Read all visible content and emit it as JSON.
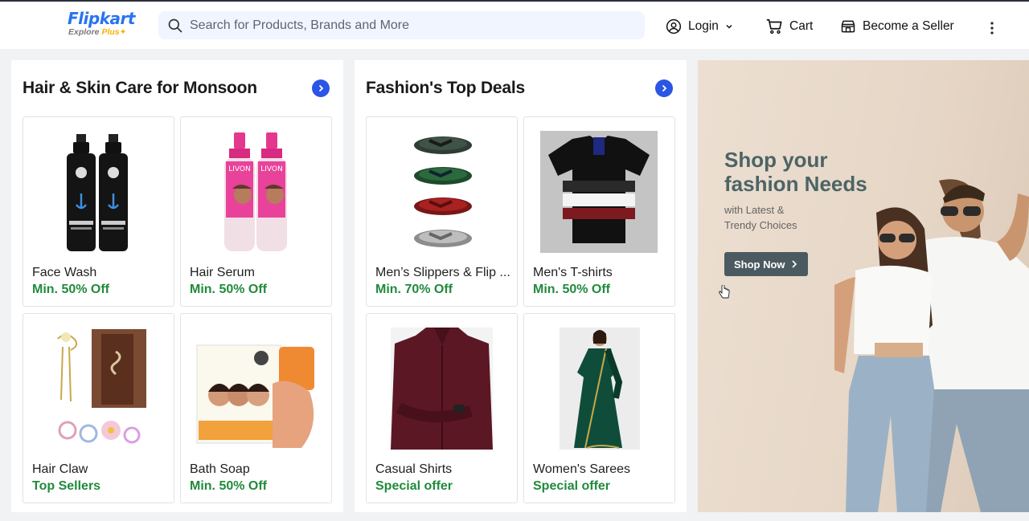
{
  "header": {
    "logo_main": "Flipkart",
    "logo_sub": "Explore",
    "logo_plus": "Plus",
    "search_placeholder": "Search for Products, Brands and More",
    "login_label": "Login",
    "cart_label": "Cart",
    "seller_label": "Become a Seller"
  },
  "sections": [
    {
      "title": "Hair & Skin Care for Monsoon",
      "items": [
        {
          "name": "Face Wash",
          "offer": "Min. 50% Off"
        },
        {
          "name": "Hair Serum",
          "offer": "Min. 50% Off"
        },
        {
          "name": "Hair Claw",
          "offer": "Top Sellers"
        },
        {
          "name": "Bath Soap",
          "offer": "Min. 50% Off"
        }
      ]
    },
    {
      "title": "Fashion's Top Deals",
      "items": [
        {
          "name": "Men’s Slippers & Flip ...",
          "offer": "Min. 70% Off"
        },
        {
          "name": "Men's T-shirts",
          "offer": "Min. 50% Off"
        },
        {
          "name": "Casual Shirts",
          "offer": "Special offer"
        },
        {
          "name": "Women's Sarees",
          "offer": "Special offer"
        }
      ]
    }
  ],
  "banner": {
    "title_line1": "Shop your",
    "title_line2": "fashion Needs",
    "sub_line1": "with Latest &",
    "sub_line2": "Trendy Choices",
    "button_label": "Shop Now"
  },
  "colors": {
    "brand_blue": "#2874f0",
    "offer_green": "#218a3c",
    "arrow_blue": "#2a55e5"
  }
}
